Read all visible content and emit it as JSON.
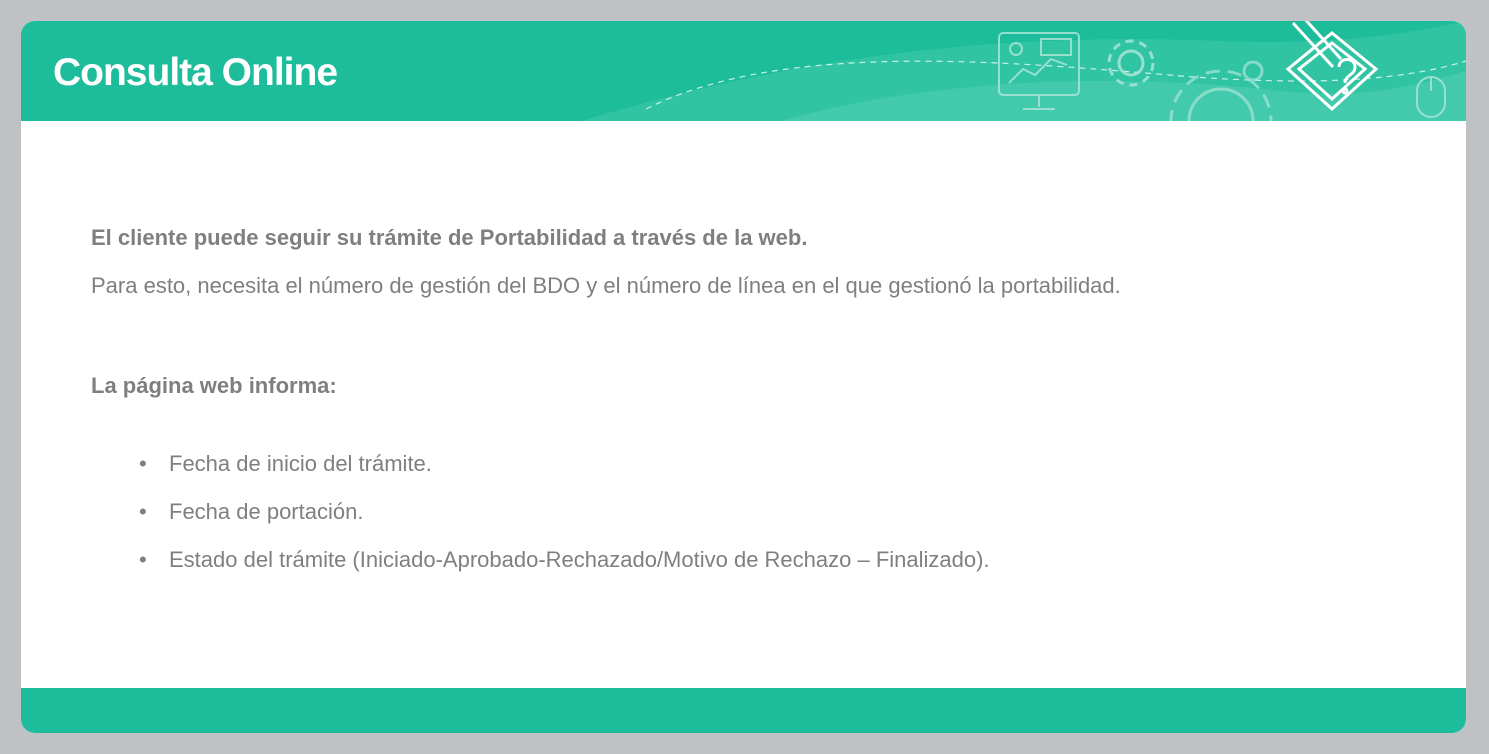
{
  "header": {
    "title": "Consulta Online",
    "color": "#1dbc9a",
    "icons": [
      "monitor-icon",
      "gear-icon",
      "large-gear-icon",
      "pencil-question-icon",
      "mouse-icon"
    ]
  },
  "content": {
    "lead": "El cliente puede seguir su trámite de Portabilidad a través de la web.",
    "paragraph": "Para esto, necesita el número de gestión del BDO y el número de línea en el que gestionó la portabilidad.",
    "subheading": "La página web informa:",
    "bullet_char": "•",
    "items": [
      "Fecha de inicio del trámite.",
      "Fecha de portación.",
      "Estado del trámite (Iniciado-Aprobado-Rechazado/Motivo de Rechazo – Finalizado)."
    ]
  },
  "colors": {
    "accent": "#1dbc9a",
    "text": "#7f7f7f",
    "frame": "#bfc2c5"
  }
}
